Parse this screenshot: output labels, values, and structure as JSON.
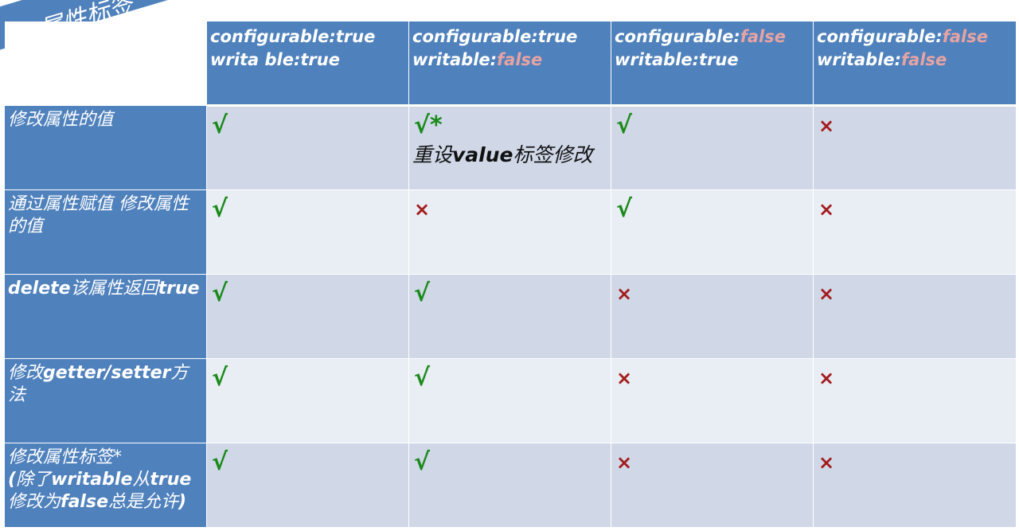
{
  "banner": "属性标签",
  "headers": [
    [
      {
        "t": "configurable:true  writa ble:true",
        "f": false
      }
    ],
    [
      {
        "t": "configurable:true",
        "f": false
      },
      {
        "t": "\nwritable:",
        "f": false
      },
      {
        "t": "false",
        "f": true
      }
    ],
    [
      {
        "t": "configurable:",
        "f": false
      },
      {
        "t": "false",
        "f": true
      },
      {
        "t": "\nwritable:true",
        "f": false
      }
    ],
    [
      {
        "t": "configurable:",
        "f": false
      },
      {
        "t": "false",
        "f": true
      },
      {
        "t": "\nwritable:",
        "f": false
      },
      {
        "t": "false",
        "f": true
      }
    ]
  ],
  "rows": [
    {
      "label": [
        {
          "t": "修改属性的值",
          "b": false
        }
      ],
      "cells": [
        "yes",
        "yes*",
        "yes",
        "no"
      ]
    },
    {
      "label": [
        {
          "t": "通过属性赋值  修改属性的值",
          "b": false
        }
      ],
      "cells": [
        "yes",
        "no",
        "yes",
        "no"
      ]
    },
    {
      "label": [
        {
          "t": "delete",
          "b": true
        },
        {
          "t": "该属性返回",
          "b": false
        },
        {
          "t": "true",
          "b": true
        }
      ],
      "cells": [
        "yes",
        "yes",
        "no",
        "no"
      ]
    },
    {
      "label": [
        {
          "t": "修改",
          "b": false
        },
        {
          "t": "getter/setter",
          "b": true
        },
        {
          "t": "方法",
          "b": false
        }
      ],
      "cells": [
        "yes",
        "yes",
        "no",
        "no"
      ]
    },
    {
      "label": [
        {
          "t": "修改属性标签*",
          "b": false
        },
        {
          "t": "\n(",
          "b": true
        },
        {
          "t": "除了",
          "b": false
        },
        {
          "t": "writable",
          "b": true
        },
        {
          "t": "从",
          "b": false
        },
        {
          "t": "true",
          "b": true
        },
        {
          "t": "修改为",
          "b": false
        },
        {
          "t": "false",
          "b": true
        },
        {
          "t": "总是允许",
          "b": false
        },
        {
          "t": ")",
          "b": true
        }
      ],
      "cells": [
        "yes",
        "yes",
        "no",
        "no"
      ]
    }
  ],
  "note_parts": [
    {
      "t": "重设",
      "b": false
    },
    {
      "t": "value",
      "b": true
    },
    {
      "t": "标签修改",
      "b": false
    }
  ],
  "symbols": {
    "yes": "√",
    "yes_star": "√*",
    "no": "×"
  },
  "colors": {
    "header_bg": "#4f81bd",
    "row_dark": "#d0d8e8",
    "row_light": "#e9edf4",
    "check": "#1a8a1a",
    "cross": "#a31c1c",
    "false_text": "#e6a3a3"
  }
}
